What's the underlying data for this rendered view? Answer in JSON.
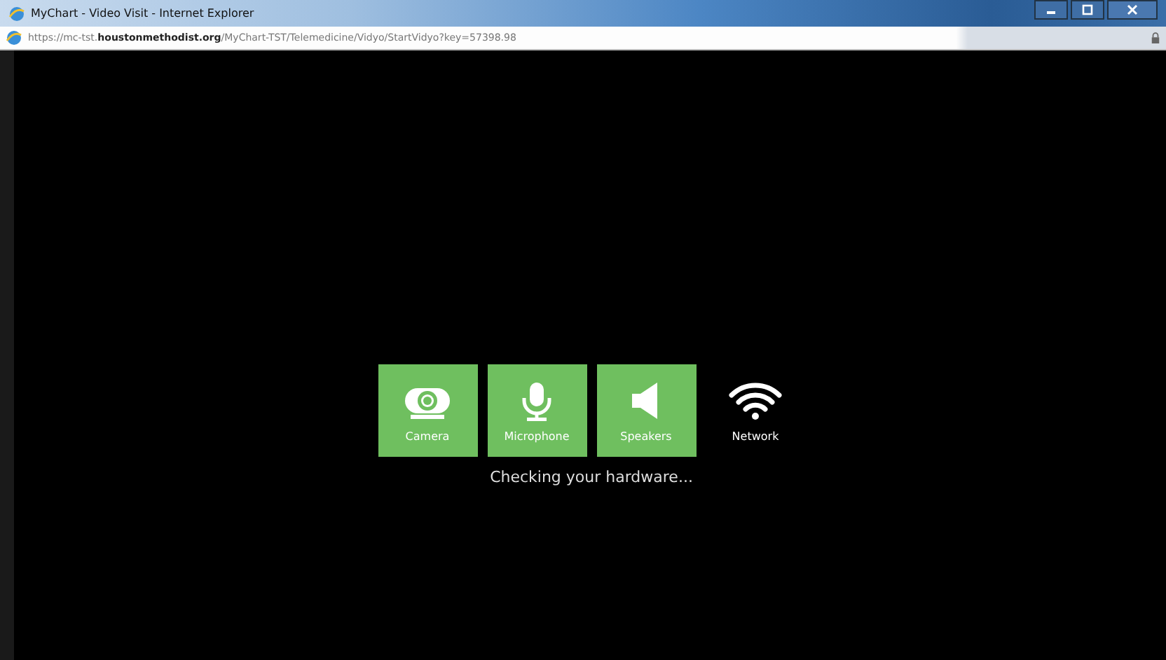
{
  "window": {
    "title": "MyChart - Video Visit - Internet Explorer"
  },
  "address_bar": {
    "url_start": "https://mc-tst.",
    "url_domain": "houstonmethodist.org",
    "url_path": "/MyChart-TST/Telemedicine/Vidyo/StartVidyo?key=57398.98"
  },
  "hardware_checks": [
    {
      "kind": "camera",
      "label": "Camera",
      "done": true
    },
    {
      "kind": "microphone",
      "label": "Microphone",
      "done": true
    },
    {
      "kind": "speakers",
      "label": "Speakers",
      "done": true
    },
    {
      "kind": "network",
      "label": "Network",
      "done": false
    }
  ],
  "status": "Checking your hardware..."
}
